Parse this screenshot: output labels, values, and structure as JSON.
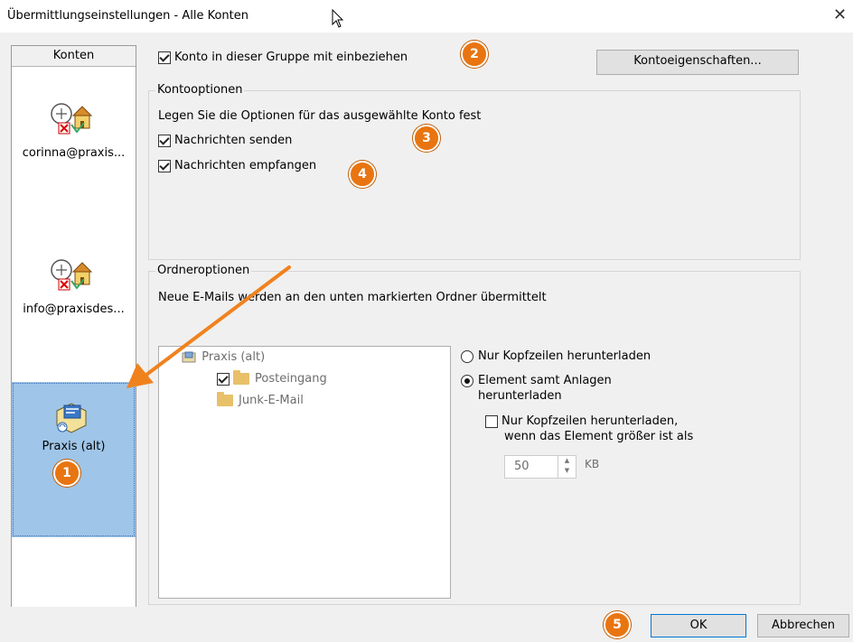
{
  "window": {
    "title": "Übermittlungseinstellungen - Alle Konten",
    "close_glyph": "✕"
  },
  "accounts": {
    "header": "Konten",
    "items": [
      {
        "label": "corinna@praxis...",
        "icon": "account-computer-house-icon"
      },
      {
        "label": "info@praxisdes...",
        "icon": "account-computer-house-icon"
      },
      {
        "label": "Praxis (alt)",
        "icon": "pst-data-file-icon",
        "selected": true
      }
    ]
  },
  "top": {
    "include_checkbox": {
      "label": "Konto in dieser Gruppe mit einbeziehen",
      "checked": true
    },
    "properties_button": "Kontoeigenschaften..."
  },
  "account_options": {
    "legend": "Kontooptionen",
    "description": "Legen Sie die Optionen für das ausgewählte Konto fest",
    "send": {
      "label": "Nachrichten senden",
      "checked": true
    },
    "receive": {
      "label": "Nachrichten empfangen",
      "checked": true
    }
  },
  "folder_options": {
    "legend": "Ordneroptionen",
    "description": "Neue E-Mails werden an den unten markierten Ordner übermittelt",
    "tree": {
      "root": "Praxis (alt)",
      "children": [
        {
          "label": "Posteingang",
          "checked": true
        },
        {
          "label": "Junk-E-Mail"
        }
      ]
    },
    "radio_headers": {
      "label": "Nur Kopfzeilen herunterladen",
      "selected": false
    },
    "radio_full": {
      "label_line1": "Element samt Anlagen",
      "label_line2": "herunterladen",
      "selected": true
    },
    "size_limit": {
      "label_line1": "Nur Kopfzeilen herunterladen,",
      "label_line2": "wenn das Element größer ist als",
      "checked": false,
      "value": "50",
      "unit": "KB"
    }
  },
  "footer": {
    "ok": "OK",
    "cancel": "Abbrechen"
  },
  "badges": [
    "1",
    "2",
    "3",
    "4",
    "5"
  ],
  "colors": {
    "badge": "#e87511",
    "arrow": "#f0821e",
    "selection": "#9fc5e8"
  }
}
